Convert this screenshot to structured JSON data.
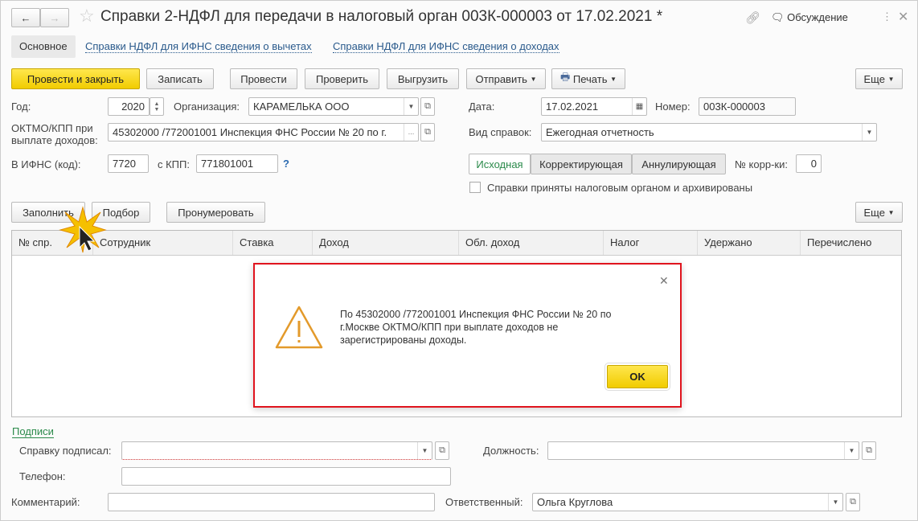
{
  "header": {
    "title": "Справки 2-НДФЛ для передачи в налоговый орган 003К-000003 от 17.02.2021 *",
    "discussion": "Обсуждение"
  },
  "tabs": [
    "Основное",
    "Справки НДФЛ для ИФНС сведения о вычетах",
    "Справки НДФЛ для ИФНС сведения о доходах"
  ],
  "toolbar": {
    "post_close": "Провести и закрыть",
    "save": "Записать",
    "post": "Провести",
    "check": "Проверить",
    "export": "Выгрузить",
    "send": "Отправить",
    "print": "Печать",
    "more": "Еще"
  },
  "form": {
    "year_label": "Год:",
    "year": "2020",
    "org_label": "Организация:",
    "org": "КАРАМЕЛЬКА ООО",
    "date_label": "Дата:",
    "date": "17.02.2021",
    "number_label": "Номер:",
    "number": "003К-000003",
    "oktmo_label": "ОКТМО/КПП  при выплате доходов:",
    "oktmo": "45302000   /772001001 Инспекция ФНС России № 20 по г.",
    "type_label": "Вид справок:",
    "type": "Ежегодная отчетность",
    "ifns_label": "В ИФНС (код):",
    "ifns": "7720",
    "kpp_label": "с КПП:",
    "kpp": "771801001",
    "help": "?",
    "kind_buttons": [
      "Исходная",
      "Корректирующая",
      "Аннулирующая"
    ],
    "corr_label": "№ корр-ки:",
    "corr": "0",
    "archived_label": "Справки приняты налоговым органом и архивированы"
  },
  "table_toolbar": {
    "fill": "Заполнить",
    "select": "Подбор",
    "number": "Пронумеровать",
    "more": "Еще"
  },
  "table": {
    "columns": [
      "№ спр.",
      "Сотрудник",
      "Ставка",
      "Доход",
      "Обл. доход",
      "Налог",
      "Удержано",
      "Перечислено"
    ]
  },
  "footer": {
    "signatures": "Подписи",
    "signed_label": "Справку подписал:",
    "position_label": "Должность:",
    "phone_label": "Телефон:",
    "comment_label": "Комментарий:",
    "responsible_label": "Ответственный:",
    "responsible": "Ольга Круглова"
  },
  "dialog": {
    "message": "По 45302000   /772001001 Инспекция ФНС России № 20 по г.Москве ОКТМО/КПП  при выплате доходов не зарегистрированы доходы.",
    "ok": "OK"
  }
}
